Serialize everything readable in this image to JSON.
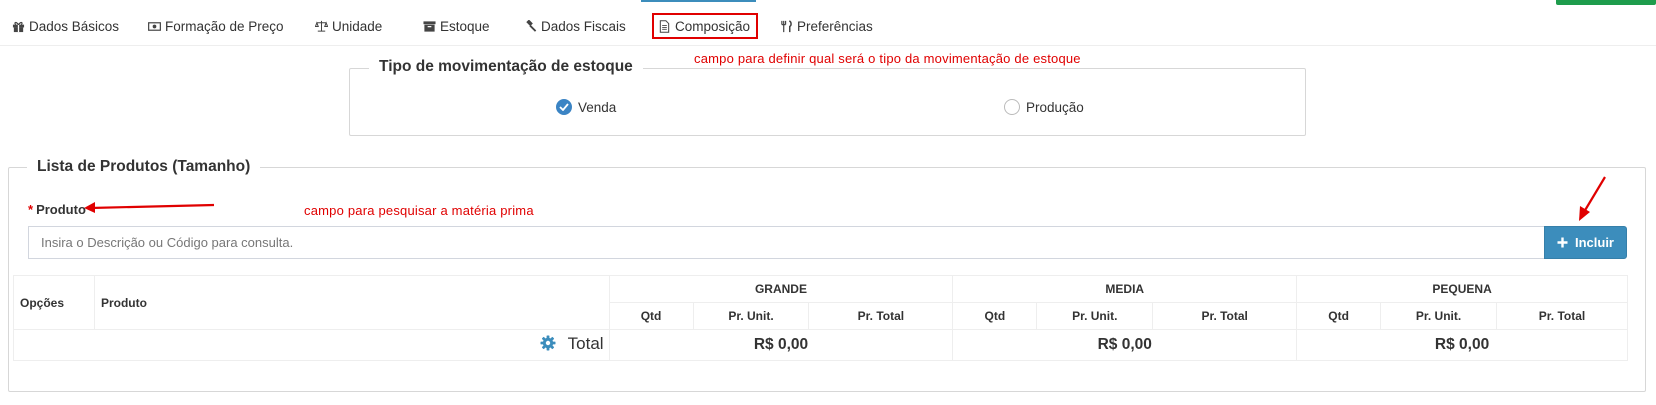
{
  "tabs": [
    {
      "label": "Dados Básicos",
      "icon": "gift-icon"
    },
    {
      "label": "Formação de Preço",
      "icon": "money-icon"
    },
    {
      "label": "Unidade",
      "icon": "balance-scale-icon"
    },
    {
      "label": "Estoque",
      "icon": "archive-icon"
    },
    {
      "label": "Dados Fiscais",
      "icon": "gavel-icon"
    },
    {
      "label": "Composição",
      "icon": "file-text-icon",
      "active": true
    },
    {
      "label": "Preferências",
      "icon": "cutlery-icon"
    }
  ],
  "annotations": {
    "stock_movement": "campo para definir qual será o tipo da movimentação de estoque",
    "search_product": "campo para pesquisar a matéria prima"
  },
  "movement": {
    "legend": "Tipo de movimentação de estoque",
    "options": [
      {
        "label": "Venda",
        "checked": true
      },
      {
        "label": "Produção",
        "checked": false
      }
    ]
  },
  "products": {
    "legend": "Lista de Produtos (Tamanho)",
    "field_label": "Produto",
    "required_mark": "*",
    "placeholder": "Insira o Descrição ou Código para consulta.",
    "add_button": "Incluir"
  },
  "table": {
    "col_options": "Opções",
    "col_product": "Produto",
    "sizes": [
      {
        "name": "GRANDE",
        "qtd": "Qtd",
        "unit": "Pr. Unit.",
        "total": "Pr. Total",
        "total_value": "R$ 0,00"
      },
      {
        "name": "MEDIA",
        "qtd": "Qtd",
        "unit": "Pr. Unit.",
        "total": "Pr. Total",
        "total_value": "R$ 0,00"
      },
      {
        "name": "PEQUENA",
        "qtd": "Qtd",
        "unit": "Pr. Unit.",
        "total": "Pr. Total",
        "total_value": "R$ 0,00"
      }
    ],
    "total_label": "Total"
  },
  "colors": {
    "primary": "#3c8dbc",
    "annotation_red": "#e00000",
    "checked_radio": "#3b84c4"
  }
}
